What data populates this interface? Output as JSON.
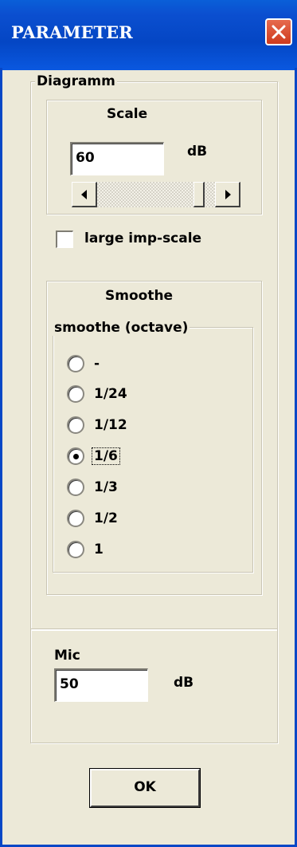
{
  "window": {
    "title": "PARAMETER",
    "close_icon": "close-icon"
  },
  "diagramm": {
    "legend": "Diagramm",
    "scale": {
      "legend": "Scale",
      "value": "60",
      "unit": "dB",
      "slider_position": 0.9
    },
    "large_imp_scale": {
      "label": "large imp-scale",
      "checked": false
    },
    "smoothe": {
      "legend": "Smoothe",
      "inner_legend": "smoothe (octave)",
      "options": [
        {
          "label": "-",
          "selected": false
        },
        {
          "label": "1/24",
          "selected": false
        },
        {
          "label": "1/12",
          "selected": false
        },
        {
          "label": "1/6",
          "selected": true
        },
        {
          "label": "1/3",
          "selected": false
        },
        {
          "label": "1/2",
          "selected": false
        },
        {
          "label": "1",
          "selected": false
        }
      ]
    }
  },
  "mic": {
    "label": "Mic",
    "value": "50",
    "unit": "dB"
  },
  "ok_button": {
    "label": "OK"
  }
}
